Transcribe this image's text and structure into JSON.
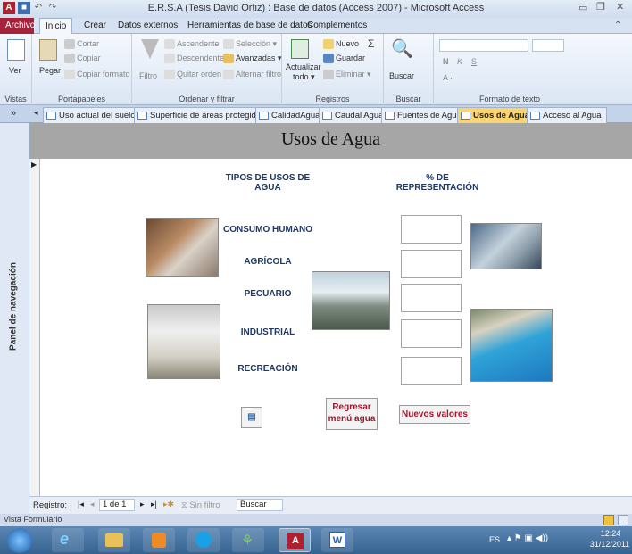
{
  "window": {
    "title": "E.R.S.A (Tesis David Ortiz) : Base de datos (Access 2007)  -  Microsoft Access"
  },
  "ribbon_tabs": [
    "Archivo",
    "Inicio",
    "Crear",
    "Datos externos",
    "Herramientas de base de datos",
    "Complementos"
  ],
  "ribbon": {
    "vistas": {
      "ver": "Ver",
      "label": "Vistas"
    },
    "portapapeles": {
      "pegar": "Pegar",
      "cortar": "Cortar",
      "copiar": "Copiar",
      "copiar_formato": "Copiar formato",
      "label": "Portapapeles"
    },
    "ordenar": {
      "filtro": "Filtro",
      "ascendente": "Ascendente",
      "descendente": "Descendente",
      "quitar_orden": "Quitar orden",
      "seleccion": "Selección",
      "avanzadas": "Avanzadas",
      "alternar": "Alternar filtro",
      "label": "Ordenar y filtrar"
    },
    "registros": {
      "actualizar": "Actualizar",
      "todo": "todo",
      "nuevo": "Nuevo",
      "guardar": "Guardar",
      "eliminar": "Eliminar",
      "label": "Registros"
    },
    "buscar": {
      "buscar": "Buscar",
      "label": "Buscar"
    },
    "formato": {
      "label": "Formato de texto"
    }
  },
  "doc_tabs": [
    {
      "label": "Uso actual del suelo",
      "active": false
    },
    {
      "label": "Superficie de áreas protegidas",
      "active": false
    },
    {
      "label": "CalidadAgua",
      "active": false
    },
    {
      "label": "Caudal Agua",
      "active": false
    },
    {
      "label": "Fuentes de Agua",
      "active": false
    },
    {
      "label": "Usos de Agua",
      "active": true
    },
    {
      "label": "Acceso al Agua",
      "active": false
    }
  ],
  "nav_pane": {
    "label": "Panel de navegación",
    "toggle": "»"
  },
  "form": {
    "title": "Usos de Agua",
    "col_tipos": "TIPOS DE USOS DE AGUA",
    "col_pct": "% DE REPRESENTACIÓN",
    "usos": [
      "CONSUMO HUMANO",
      "AGRÍCOLA",
      "PECUARIO",
      "INDUSTRIAL",
      "RECREACIÓN"
    ],
    "values": [
      "",
      "",
      "",
      "",
      ""
    ],
    "btn_regresar": "Regresar menú agua",
    "btn_nuevos": "Nuevos valores"
  },
  "record_nav": {
    "registro": "Registro:",
    "position": "1 de 1",
    "filtro": "Sin filtro",
    "buscar": "Buscar"
  },
  "status": {
    "view": "Vista Formulario"
  },
  "taskbar": {
    "lang": "ES",
    "time": "12:24",
    "date": "31/12/2011"
  },
  "colors": {
    "active_tab": "#fad470",
    "archivo": "#a6223a",
    "header": "#a6a6a6",
    "label_text": "#1f3864",
    "button_text": "#a0162c"
  }
}
